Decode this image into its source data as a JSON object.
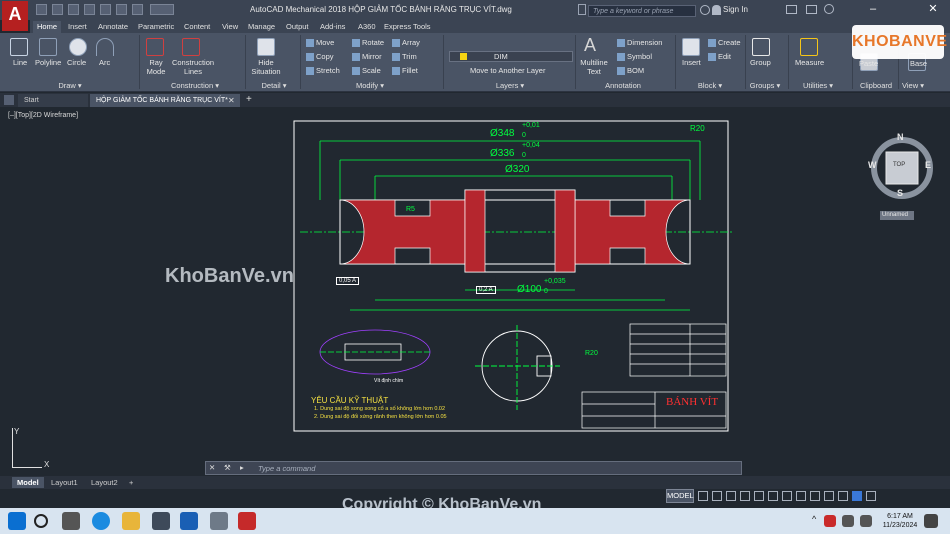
{
  "titlebar": {
    "app_logo": "A",
    "title": "AutoCAD Mechanical 2018     HỘP GIẢM TỐC BÁNH RĂNG TRỤC VÍT.dwg",
    "search_placeholder": "Type a keyword or phrase",
    "signin": "Sign In",
    "minimize": "–",
    "close": "✕"
  },
  "ribbon_tabs": [
    "Home",
    "Insert",
    "Annotate",
    "Parametric",
    "Content",
    "View",
    "Manage",
    "Output",
    "Add-ins",
    "A360",
    "Express Tools"
  ],
  "ribbon": {
    "draw": {
      "label": "Draw ▾",
      "tools": [
        "Line",
        "Polyline",
        "Circle",
        "Arc"
      ]
    },
    "construction": {
      "label": "Construction ▾",
      "tools": [
        "Ray Mode",
        "Construction Lines"
      ]
    },
    "detail": {
      "label": "Detail ▾",
      "tools": [
        "Hide Situation"
      ]
    },
    "modify": {
      "label": "Modify ▾",
      "tools": [
        "Move",
        "Rotate",
        "Array",
        "Copy",
        "Mirror",
        "Trim",
        "Stretch",
        "Scale",
        "Fillet"
      ]
    },
    "layers": {
      "label": "Layers ▾",
      "current": "DIM",
      "move_to": "Move to Another Layer"
    },
    "annotation": {
      "label": "Annotation",
      "tools": [
        "Multiline Text",
        "Dimension",
        "Symbol",
        "BOM"
      ]
    },
    "block": {
      "label": "Block ▾",
      "tools": [
        "Insert",
        "Create",
        "Edit"
      ]
    },
    "groups": {
      "label": "Groups ▾",
      "tools": [
        "Group"
      ]
    },
    "utilities": {
      "label": "Utilities ▾",
      "tools": [
        "Measure"
      ]
    },
    "clipboard": {
      "label": "Clipboard",
      "tools": [
        "Paste"
      ]
    },
    "view": {
      "label": "View ▾",
      "tools": [
        "Base"
      ]
    }
  },
  "doc_tabs": [
    "Start",
    "HỘP GIẢM TỐC BÁNH RĂNG TRỤC VÍT*"
  ],
  "viewport_label": "[–][Top][2D Wireframe]",
  "viewcube": {
    "north": "N",
    "south": "S",
    "east": "E",
    "west": "W",
    "face": "TOP",
    "ucs_name": "Unnamed"
  },
  "drawing": {
    "dims": {
      "d348": "Ø348",
      "d348_tol": "+0,01",
      "d348_tol_lo": "0",
      "d336": "Ø336",
      "d336_tol": "+0,04",
      "d336_tol_lo": "0",
      "d320": "Ø320",
      "d100": "Ø100",
      "d100_tol": "+0,035",
      "d100_tol_lo": "0",
      "r20": "R20",
      "r5": "R5",
      "r20b": "R20"
    },
    "tolerance_frame": "0,05 A",
    "tolerance_frame2": "0,2 A",
    "note_label": "Vít định chìm",
    "requirements_title": "YÊU CẦU KỸ THUẬT",
    "requirements": [
      "1.   Dung sai độ song song cổ a số không lớn hơn 0.02",
      "2.   Dung sai độ đối xứng rãnh then không lớn hơn 0.05"
    ],
    "title_block_name": "BÁNH VÍT"
  },
  "cmdline": {
    "placeholder": "Type a command"
  },
  "layout_tabs": [
    "Model",
    "Layout1",
    "Layout2",
    "+"
  ],
  "statusbar": {
    "model": "MODEL"
  },
  "taskbar": {
    "time": "6:17 AM",
    "date": "11/23/2024"
  },
  "watermarks": {
    "main": "KhoBanVe.vn",
    "copyright": "Copyright © KhoBanVe.vn",
    "badge": "KHOBANVE"
  },
  "colors": {
    "drawing_bg": "#212830",
    "ribbon": "#4a5465",
    "green_line": "#00ff3f",
    "section_hatch": "#b5262e",
    "white_line": "#ffffff"
  }
}
